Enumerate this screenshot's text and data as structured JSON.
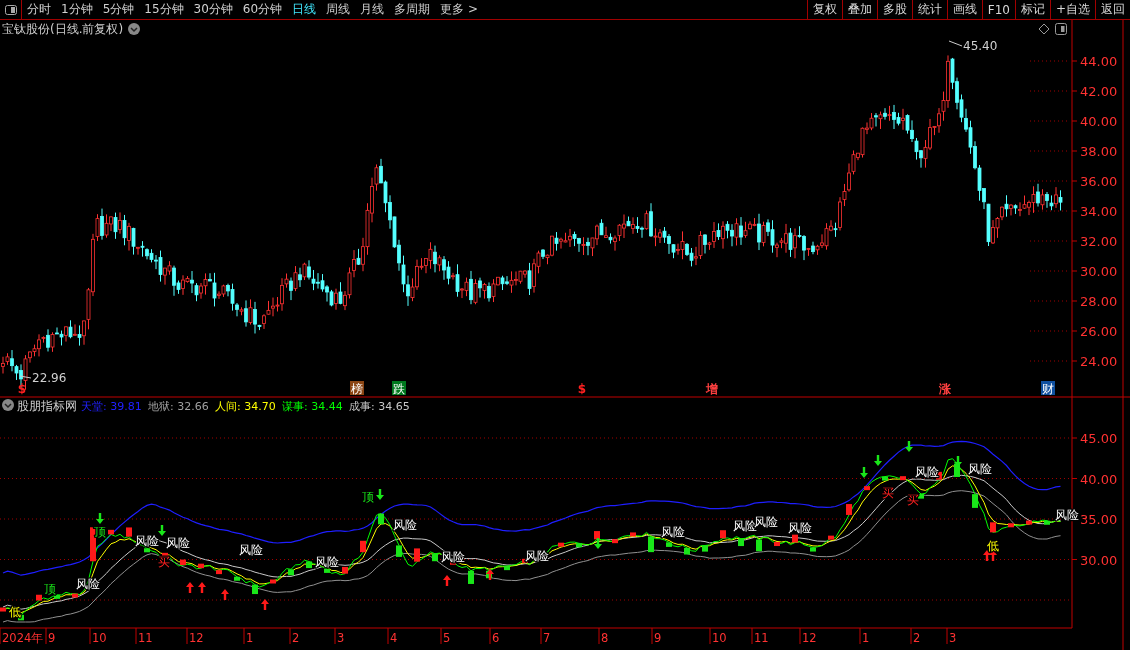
{
  "toolbar": {
    "periods": [
      {
        "label": "分时",
        "selected": false
      },
      {
        "label": "1分钟",
        "selected": false
      },
      {
        "label": "5分钟",
        "selected": false
      },
      {
        "label": "15分钟",
        "selected": false
      },
      {
        "label": "30分钟",
        "selected": false
      },
      {
        "label": "60分钟",
        "selected": false
      },
      {
        "label": "日线",
        "selected": true
      },
      {
        "label": "周线",
        "selected": false
      },
      {
        "label": "月线",
        "selected": false
      },
      {
        "label": "多周期",
        "selected": false
      },
      {
        "label": "更多 >",
        "selected": false
      }
    ],
    "actions": [
      "复权",
      "叠加",
      "多股",
      "统计",
      "画线",
      "F10",
      "标记",
      "+自选",
      "返回"
    ]
  },
  "main_chart": {
    "title": "宝钛股份(日线.前复权)",
    "high_label": "45.40",
    "low_label": "22.96",
    "price_axis": [
      "44.00",
      "42.00",
      "40.00",
      "38.00",
      "36.00",
      "34.00",
      "32.00",
      "30.00",
      "28.00",
      "26.00",
      "24.00"
    ],
    "event_markers": [
      {
        "text": "$",
        "kind": "plain",
        "color": "#ff2020"
      },
      {
        "text": "榜",
        "kind": "box",
        "color": "#8b4513"
      },
      {
        "text": "跌",
        "kind": "box",
        "color": "#00781e"
      },
      {
        "text": "$",
        "kind": "plain",
        "color": "#ff2020"
      },
      {
        "text": "增",
        "kind": "plain",
        "color": "#ff4040"
      },
      {
        "text": "涨",
        "kind": "plain",
        "color": "#ff4040"
      },
      {
        "text": "财",
        "kind": "box",
        "color": "#1050a0"
      }
    ]
  },
  "indicator": {
    "name": "股朋指标网",
    "legend": [
      {
        "text": "天堂: 39.81",
        "color": "#2020ff"
      },
      {
        "text": "地狱: 32.66",
        "color": "#a0a0a0"
      },
      {
        "text": "人间: 34.70",
        "color": "#ffff00"
      },
      {
        "text": "谋事: 34.44",
        "color": "#00ff00"
      },
      {
        "text": "成事: 34.65",
        "color": "#c8c8c8"
      }
    ],
    "axis": [
      "45.00",
      "40.00",
      "35.00",
      "30.00"
    ],
    "risk_labels": [
      "风险",
      "风险",
      "风险",
      "风险",
      "风险",
      "风险",
      "风险",
      "风险",
      "风险",
      "风险",
      "风险",
      "风险",
      "风险",
      "风险",
      "风险"
    ],
    "top_labels": [
      "顶",
      "顶",
      "顶"
    ],
    "low_labels": [
      "低",
      "低"
    ],
    "buy_labels": [
      "买",
      "买",
      "买"
    ]
  },
  "date_axis": [
    "2024年",
    "9",
    "10",
    "11",
    "12",
    "1",
    "2",
    "3",
    "4",
    "5",
    "6",
    "7",
    "8",
    "9",
    "10",
    "11",
    "12",
    "1",
    "2",
    "3"
  ]
}
